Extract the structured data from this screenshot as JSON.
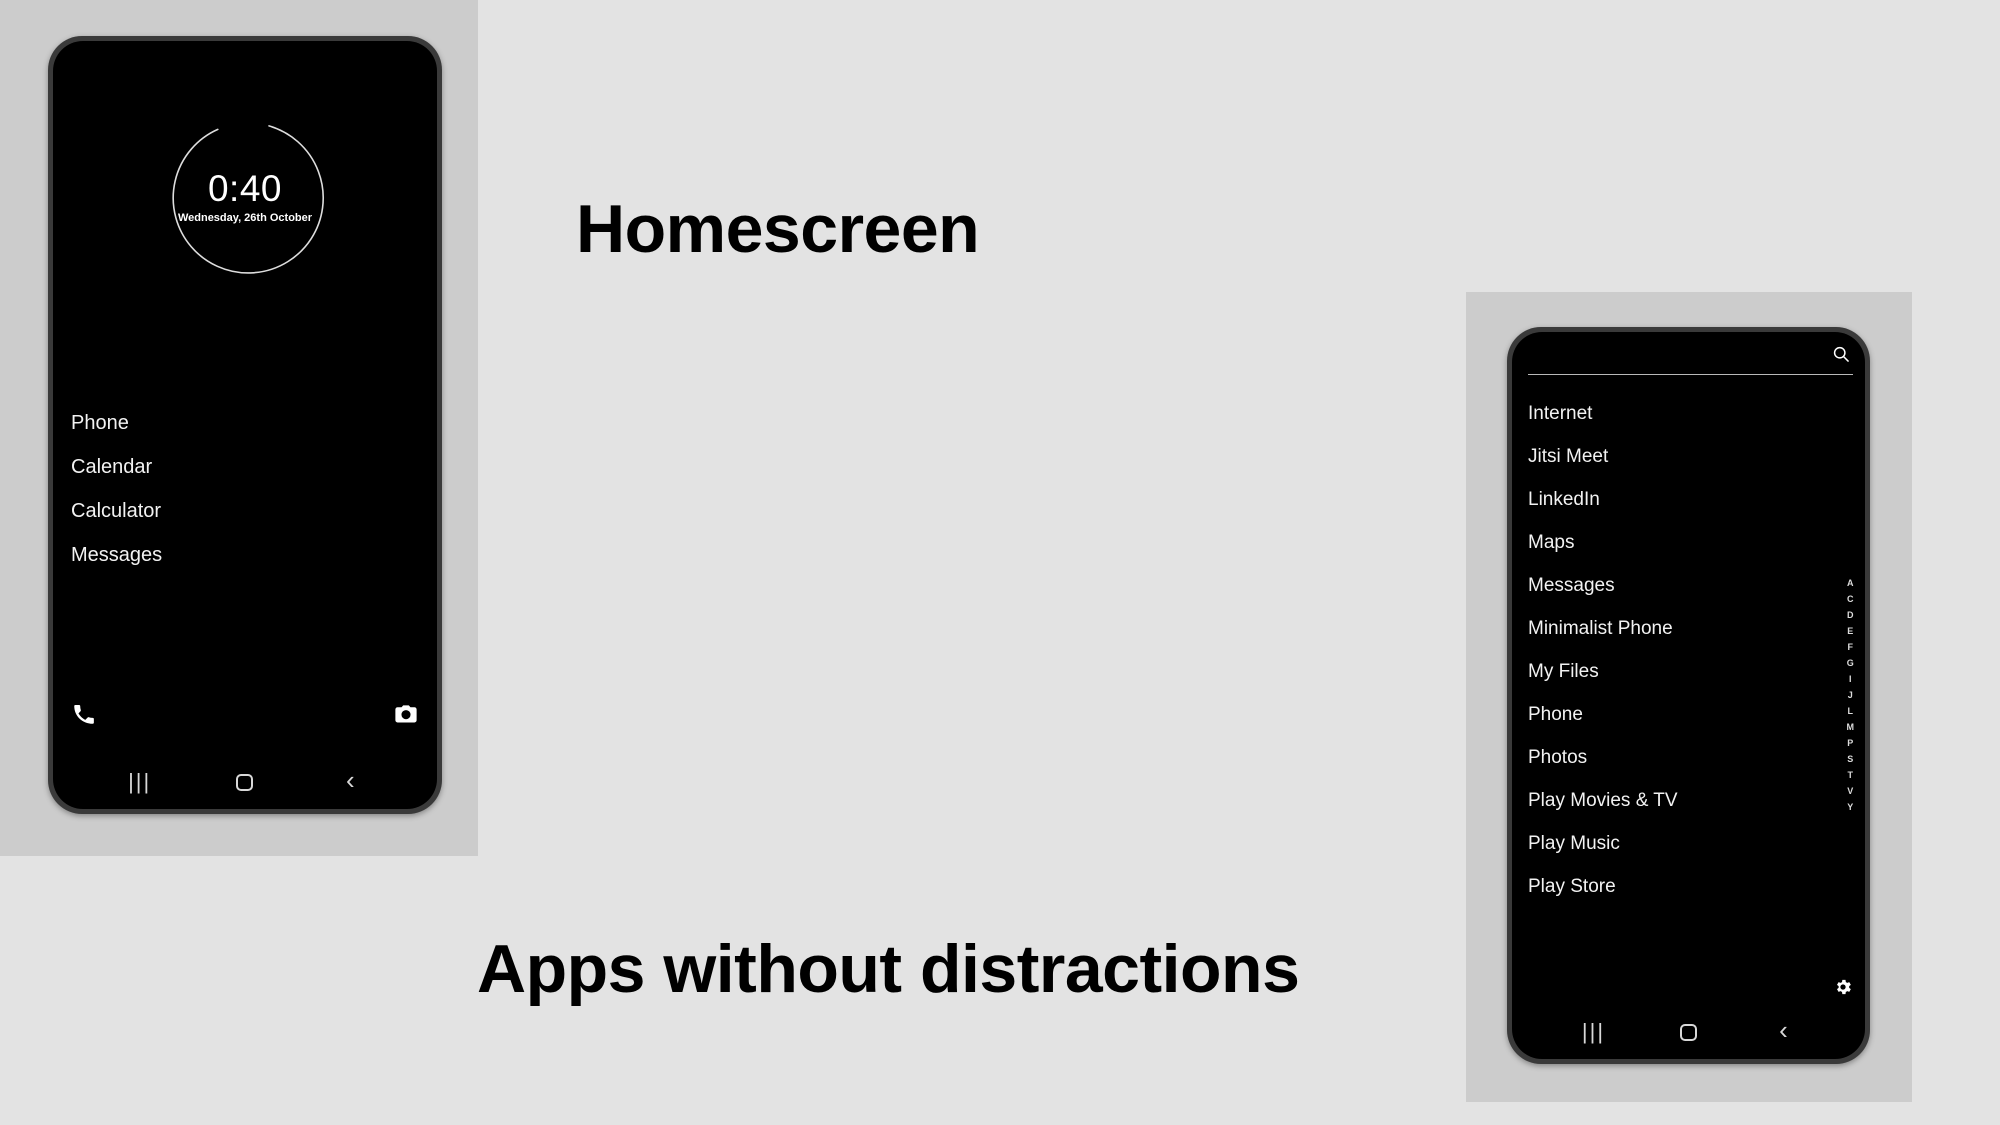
{
  "canvas": {
    "background_color": "#e3e3e3",
    "panel_color": "#cccccc"
  },
  "headings": {
    "homescreen": "Homescreen",
    "apps": "Apps without distractions"
  },
  "homescreen_phone": {
    "clock_widget": {
      "time": "0:40",
      "date": "Wednesday, 26th October",
      "ring_color": "#dddddd"
    },
    "app_shortcuts": [
      {
        "label": "Phone"
      },
      {
        "label": "Calendar"
      },
      {
        "label": "Calculator"
      },
      {
        "label": "Messages"
      }
    ],
    "quick_actions": [
      {
        "name": "phone-icon",
        "label": "Phone"
      },
      {
        "name": "camera-icon",
        "label": "Camera"
      }
    ],
    "navbar": [
      {
        "name": "recents-button",
        "glyph": "|||"
      },
      {
        "name": "home-button",
        "glyph": ""
      },
      {
        "name": "back-button",
        "glyph": "‹"
      }
    ]
  },
  "app_drawer_phone": {
    "search": {
      "value": "",
      "placeholder": "",
      "icon": "search-icon"
    },
    "apps": [
      {
        "label": "Internet"
      },
      {
        "label": "Jitsi Meet"
      },
      {
        "label": "LinkedIn"
      },
      {
        "label": "Maps"
      },
      {
        "label": "Messages"
      },
      {
        "label": "Minimalist Phone"
      },
      {
        "label": "My Files"
      },
      {
        "label": "Phone"
      },
      {
        "label": "Photos"
      },
      {
        "label": "Play Movies & TV"
      },
      {
        "label": "Play Music"
      },
      {
        "label": "Play Store"
      }
    ],
    "alphabet_index": [
      "A",
      "C",
      "D",
      "E",
      "F",
      "G",
      "I",
      "J",
      "L",
      "M",
      "P",
      "S",
      "T",
      "V",
      "Y"
    ],
    "settings_icon": "gear-icon",
    "navbar": [
      {
        "name": "recents-button",
        "glyph": "|||"
      },
      {
        "name": "home-button",
        "glyph": ""
      },
      {
        "name": "back-button",
        "glyph": "‹"
      }
    ]
  }
}
